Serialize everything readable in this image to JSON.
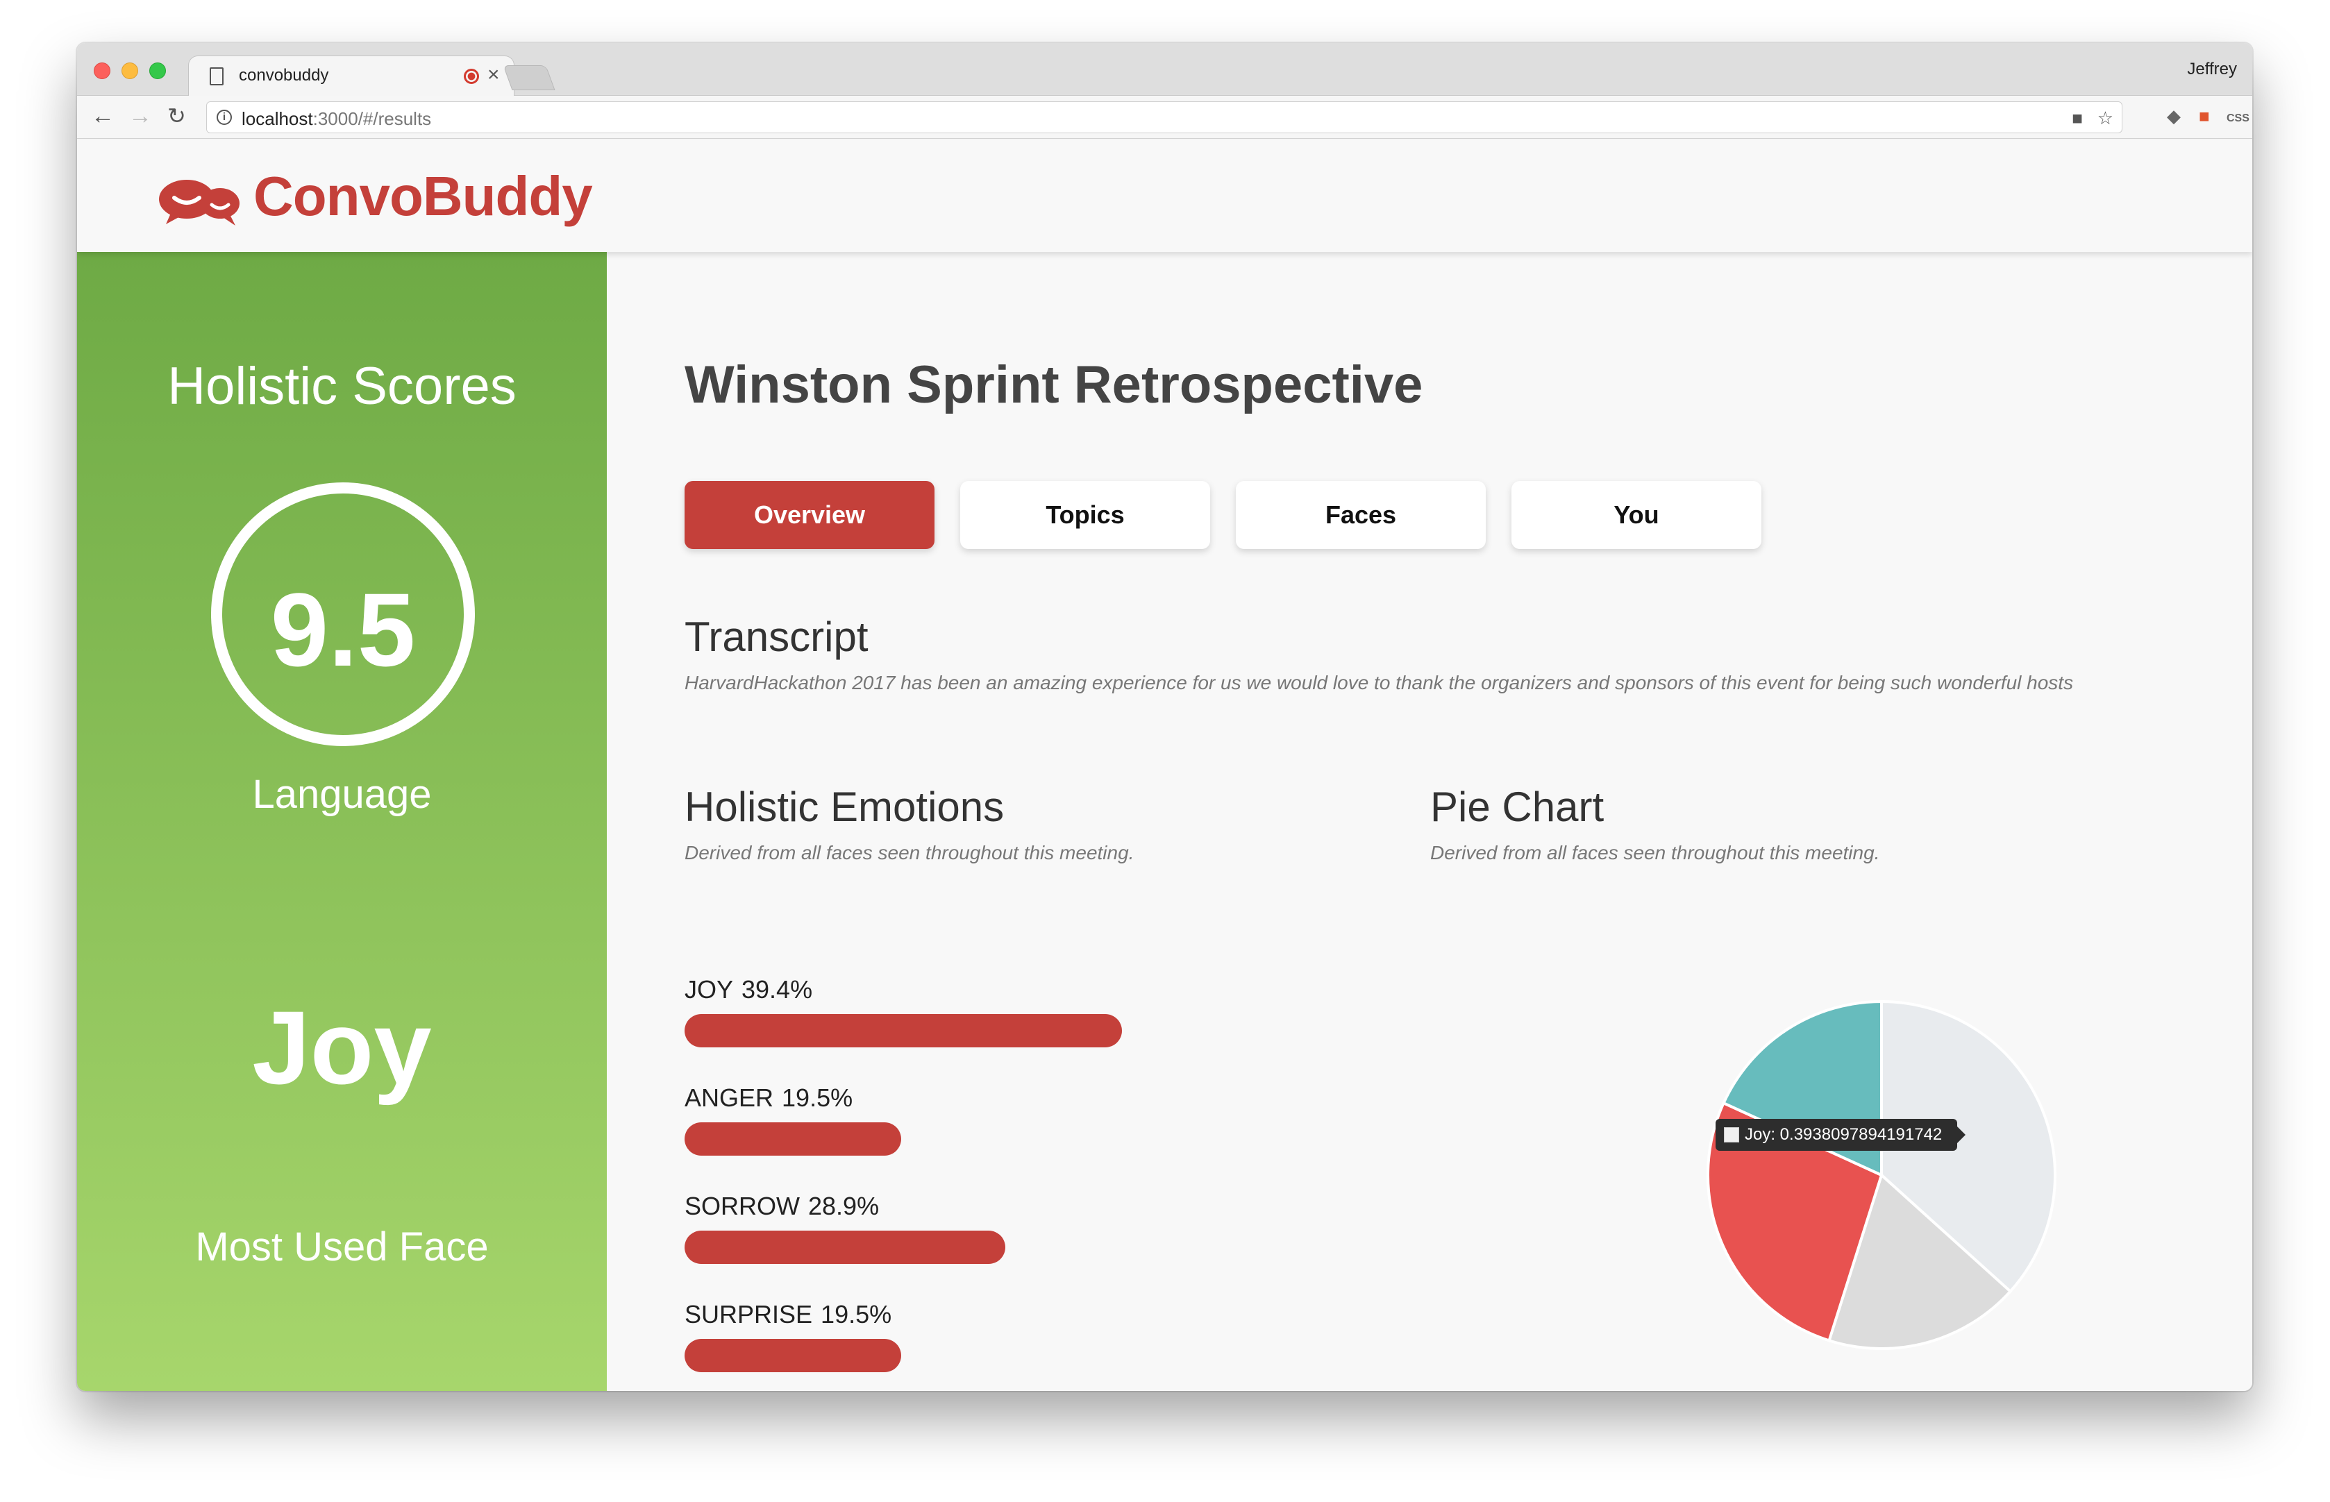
{
  "browser": {
    "tab_title": "convobuddy",
    "profile_name": "Jeffrey",
    "url_host": "localhost",
    "url_rest": ":3000/#/results"
  },
  "app": {
    "logo_text": "ConvoBuddy",
    "brand_color": "#c4403a"
  },
  "sidebar": {
    "title": "Holistic Scores",
    "score": "9.5",
    "score_label": "Language",
    "emotion": "Joy",
    "emotion_label": "Most Used Face",
    "gradient_top": "#6eaa45",
    "gradient_bottom": "#a7d66c"
  },
  "main": {
    "meeting_title": "Winston Sprint Retrospective",
    "tabs": [
      {
        "label": "Overview",
        "active": true
      },
      {
        "label": "Topics",
        "active": false
      },
      {
        "label": "Faces",
        "active": false
      },
      {
        "label": "You",
        "active": false
      }
    ],
    "transcript": {
      "heading": "Transcript",
      "text": "HarvardHackathon 2017 has been an amazing experience for us we would love to thank the organizers and sponsors of this event for being such wonderful hosts"
    },
    "emotions": {
      "heading": "Holistic Emotions",
      "subtitle": "Derived from all faces seen throughout this meeting.",
      "items": [
        {
          "name": "JOY",
          "percent_label": "39.4%",
          "value": 39.4
        },
        {
          "name": "ANGER",
          "percent_label": "19.5%",
          "value": 19.5
        },
        {
          "name": "SORROW",
          "percent_label": "28.9%",
          "value": 28.9
        },
        {
          "name": "SURPRISE",
          "percent_label": "19.5%",
          "value": 19.5
        }
      ]
    },
    "pie": {
      "heading": "Pie Chart",
      "subtitle": "Derived from all faces seen throughout this meeting.",
      "tooltip": "Joy: 0.3938097894191742"
    }
  },
  "chart_data": {
    "type": "pie",
    "categories": [
      "Joy",
      "Anger",
      "Sorrow",
      "Surprise"
    ],
    "values": [
      0.3938097894191742,
      0.1952,
      0.2891,
      0.1952
    ],
    "colors": [
      "#e8ebee",
      "#dcdcdc",
      "#e85250",
      "#67bcbd"
    ],
    "title": "",
    "legend": "none"
  }
}
